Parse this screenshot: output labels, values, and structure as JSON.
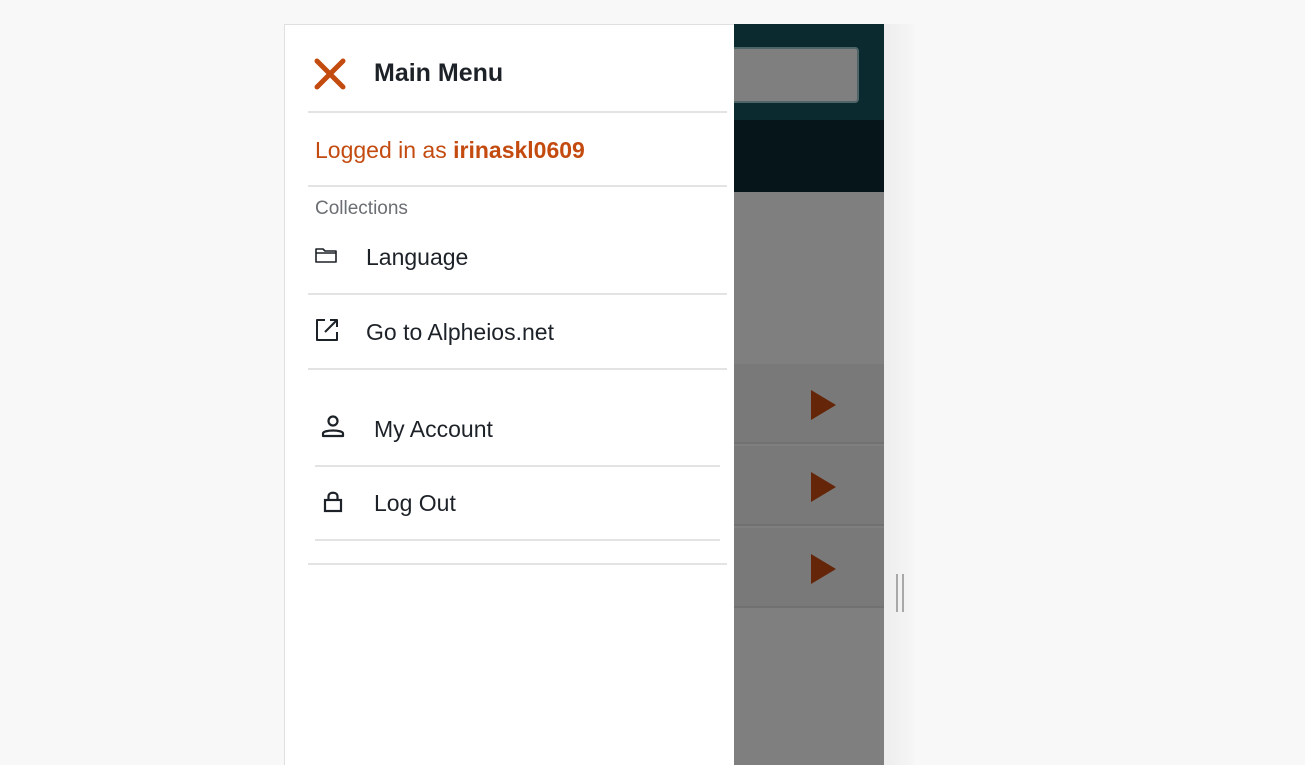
{
  "menu": {
    "title": "Main Menu",
    "logged_in_prefix": "Logged in as ",
    "username": "irinaskl0609",
    "section_label": "Collections",
    "items": [
      {
        "label": "Language",
        "icon": "folder-icon"
      },
      {
        "label": "Go to Alpheios.net",
        "icon": "external-link-icon"
      }
    ],
    "account_items": [
      {
        "label": "My Account",
        "icon": "user-icon"
      },
      {
        "label": "Log Out",
        "icon": "lock-icon"
      }
    ]
  },
  "colors": {
    "accent": "#c44b10",
    "header_teal": "#15545e",
    "header_dark": "#0d2a33",
    "play_button": "#c84a10"
  }
}
